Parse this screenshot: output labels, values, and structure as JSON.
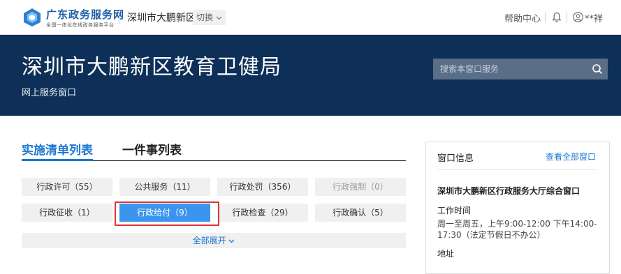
{
  "header": {
    "site_title": "广东政务服务网",
    "site_subtitle": "全国一体化在线政务服务平台",
    "region": "深圳市大鹏新区",
    "switch_label": "切换",
    "help_label": "帮助中心",
    "user_name": "**祥"
  },
  "banner": {
    "title": "深圳市大鹏新区教育卫健局",
    "subtitle": "网上服务窗口",
    "search_placeholder": "搜索本窗口服务"
  },
  "tabs": [
    {
      "label": "实施清单列表",
      "active": true
    },
    {
      "label": "一件事列表",
      "active": false
    }
  ],
  "categories": [
    {
      "label": "行政许可（55）"
    },
    {
      "label": "公共服务（11）"
    },
    {
      "label": "行政处罚（356）"
    },
    {
      "label": "行政强制（0）",
      "disabled": true
    },
    {
      "label": "行政征收（1）"
    },
    {
      "label": "行政给付（9）",
      "selected": true
    },
    {
      "label": "行政检查（29）"
    },
    {
      "label": "行政确认（5）"
    }
  ],
  "expand_label": "全部展开",
  "panel": {
    "heading": "窗口信息",
    "view_all": "查看全部窗口",
    "window_name": "深圳市大鹏新区行政服务大厅综合窗口",
    "hours_label": "工作时间",
    "hours_value": "周一至周五，上午9:00-12:00 下午14:00-17:30（法定节假日不办公）",
    "address_label": "地址"
  },
  "colors": {
    "brand_blue": "#1a76d2",
    "banner_bg": "#0e3058",
    "selected_bg": "#3b95ee",
    "highlight_red": "#e03434"
  }
}
